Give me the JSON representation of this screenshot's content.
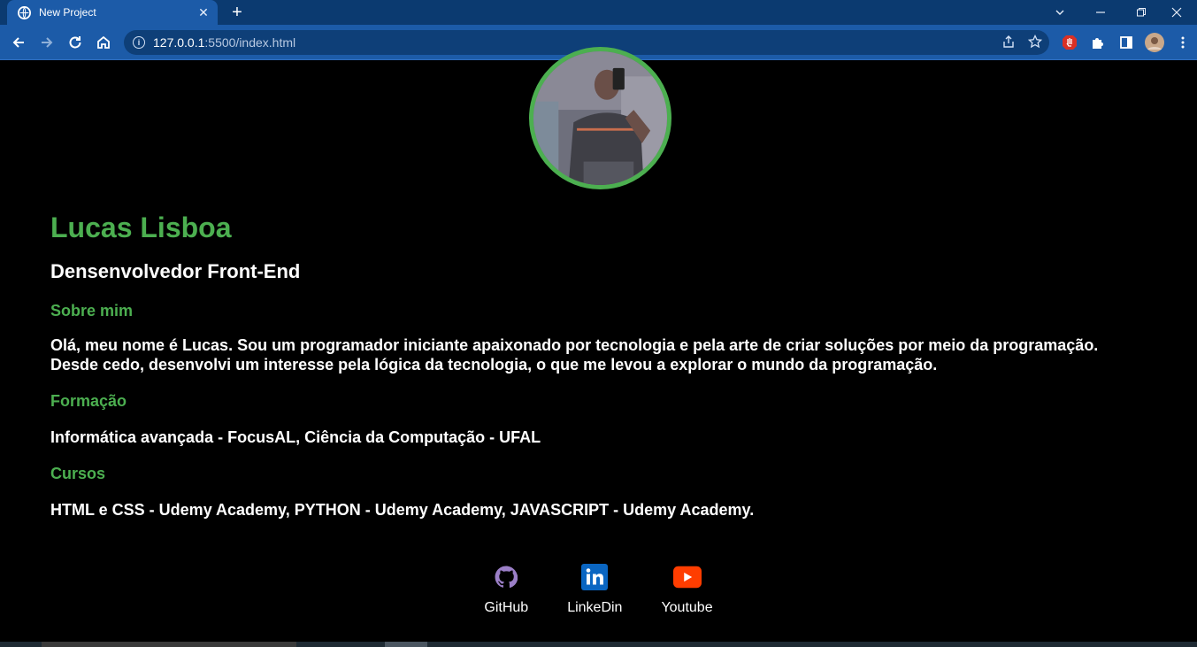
{
  "browser": {
    "tab_title": "New Project",
    "url_host": "127.0.0.1",
    "url_rest": ":5500/index.html"
  },
  "profile": {
    "name": "Lucas Lisboa",
    "role": "Densenvolvedor Front-End"
  },
  "sections": {
    "about_title": "Sobre mim",
    "about_text_1": "Olá, meu nome é Lucas. Sou um programador iniciante apaixonado por tecnologia e pela arte de criar soluções por meio da programação.",
    "about_text_2": "Desde cedo, desenvolvi um interesse pela lógica da tecnologia, o que me levou a explorar o mundo da programação.",
    "education_title": "Formação",
    "education_text": "Informática avançada - FocusAL, Ciência da Computação - UFAL",
    "courses_title": "Cursos",
    "courses_text": "HTML e CSS - Udemy Academy, PYTHON - Udemy Academy, JAVASCRIPT - Udemy Academy."
  },
  "social": [
    {
      "label": "GitHub",
      "icon": "github-icon"
    },
    {
      "label": "LinkeDin",
      "icon": "linkedin-icon"
    },
    {
      "label": "Youtube",
      "icon": "youtube-icon"
    }
  ],
  "colors": {
    "accent": "#4caf50",
    "background": "#000000",
    "browser_frame": "#0b3a70",
    "browser_toolbar": "#1c5ba8"
  }
}
